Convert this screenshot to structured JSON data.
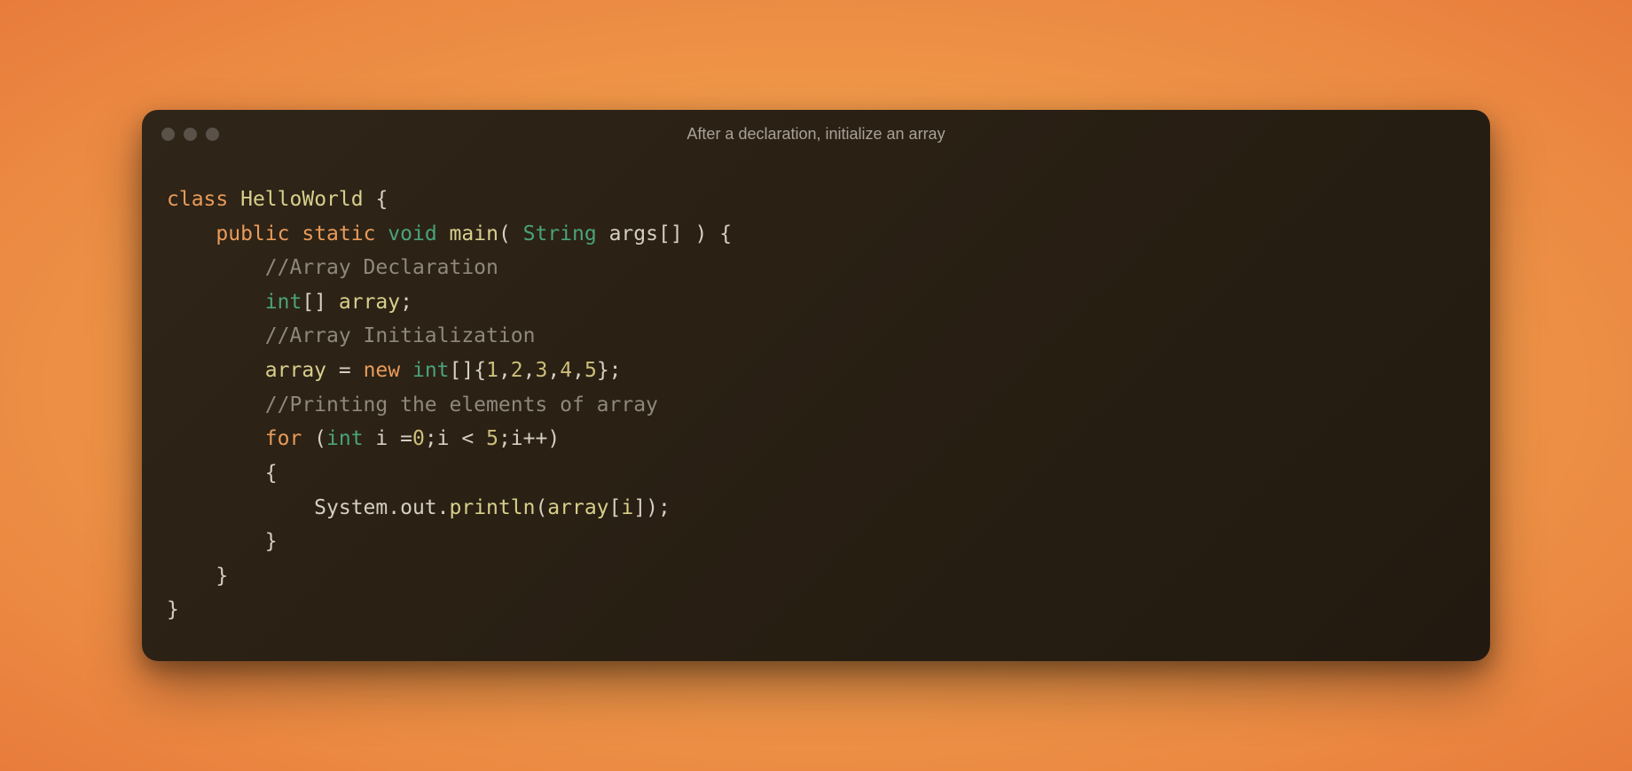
{
  "window": {
    "title": "After a declaration, initialize an array"
  },
  "code": {
    "kw_class": "class",
    "cls_name": "HelloWorld",
    "brace_open": " {",
    "kw_public": "public",
    "kw_static": "static",
    "kw_void": "void",
    "fn_main": "main",
    "paren_open": "( ",
    "type_string": "String",
    "args_decl": " args[] ) {",
    "comment_decl": "//Array Declaration",
    "kw_int": "int",
    "arr_decl": "[] ",
    "var_array": "array",
    "semi": ";",
    "comment_init": "//Array Initialization",
    "assign": " = ",
    "kw_new": "new",
    "space": " ",
    "int2": "int",
    "arr_init_open": "[]{",
    "n1": "1",
    "comma": ",",
    "n2": "2",
    "n3": "3",
    "n4": "4",
    "n5": "5",
    "arr_init_close": "};",
    "comment_print": "//Printing the elements of array",
    "kw_for": "for",
    "for_open": " (",
    "int3": "int",
    "for_i": " i =",
    "zero": "0",
    "for_mid": ";i < ",
    "five": "5",
    "for_end": ";i++)",
    "brace_open2": "{",
    "sys_out": "System.out.",
    "println": "println",
    "call_open": "(",
    "arr_ref": "array",
    "idx_open": "[",
    "idx_i": "i",
    "idx_close": "]);",
    "brace_close": "}",
    "brace_close2": "}",
    "brace_close3": "}"
  }
}
